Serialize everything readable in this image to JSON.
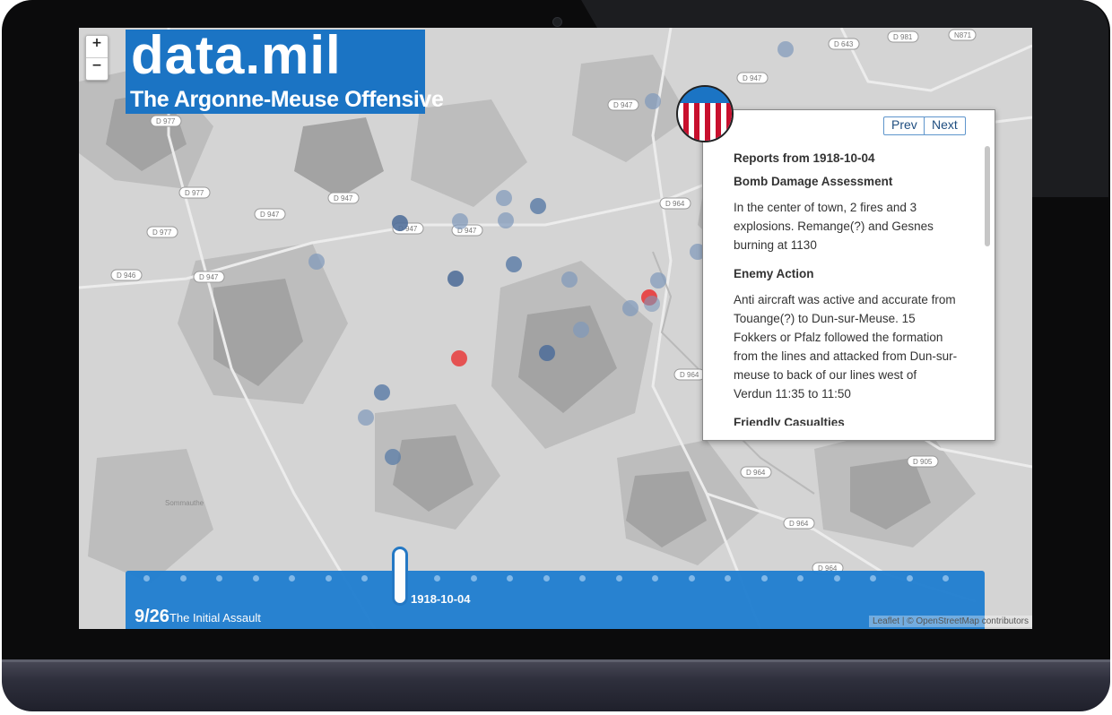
{
  "zoom": {
    "in_label": "+",
    "out_label": "−"
  },
  "title": {
    "main": "data.mil",
    "subtitle": "The Argonne-Meuse Offensive"
  },
  "road_labels": [
    "D 977",
    "D 977",
    "D 977",
    "D 947",
    "D 947",
    "D 947",
    "D 947",
    "D 947",
    "D 947",
    "D 947",
    "D 946",
    "D 964",
    "D 964",
    "D 964",
    "D 964",
    "D 964",
    "D 905",
    "D 981",
    "N871",
    "D 643"
  ],
  "map_label": "Sommauthe",
  "panel": {
    "prev_label": "Prev",
    "next_label": "Next",
    "heading": "Reports from 1918-10-04",
    "sections": [
      {
        "title": "Bomb Damage Assessment",
        "text": "In the center of town, 2 fires and 3 explosions. Remange(?) and Gesnes burning at 1130"
      },
      {
        "title": "Enemy Action",
        "text": "Anti aircraft was active and accurate from Touange(?) to Dun-sur-Meuse. 15 Fokkers or Pfalz followed the formation from the lines and attacked from Dun-sur-meuse to back of our lines west of Verdun 11:35 to 11:50"
      },
      {
        "title": "Friendly Casualties",
        "text": ""
      }
    ]
  },
  "timeline": {
    "date": "1918-10-04",
    "position": "9/26",
    "name": "The Initial Assault",
    "total_dots": 23
  },
  "attribution": "Leaflet | © OpenStreetMap contributors",
  "colors": {
    "accent": "#1b74c4",
    "marker": "#5f7fa8",
    "marker_alert": "#e83b3b",
    "seal_red": "#c8102e"
  },
  "icons": {
    "seal": "us-shield-seal-icon"
  }
}
